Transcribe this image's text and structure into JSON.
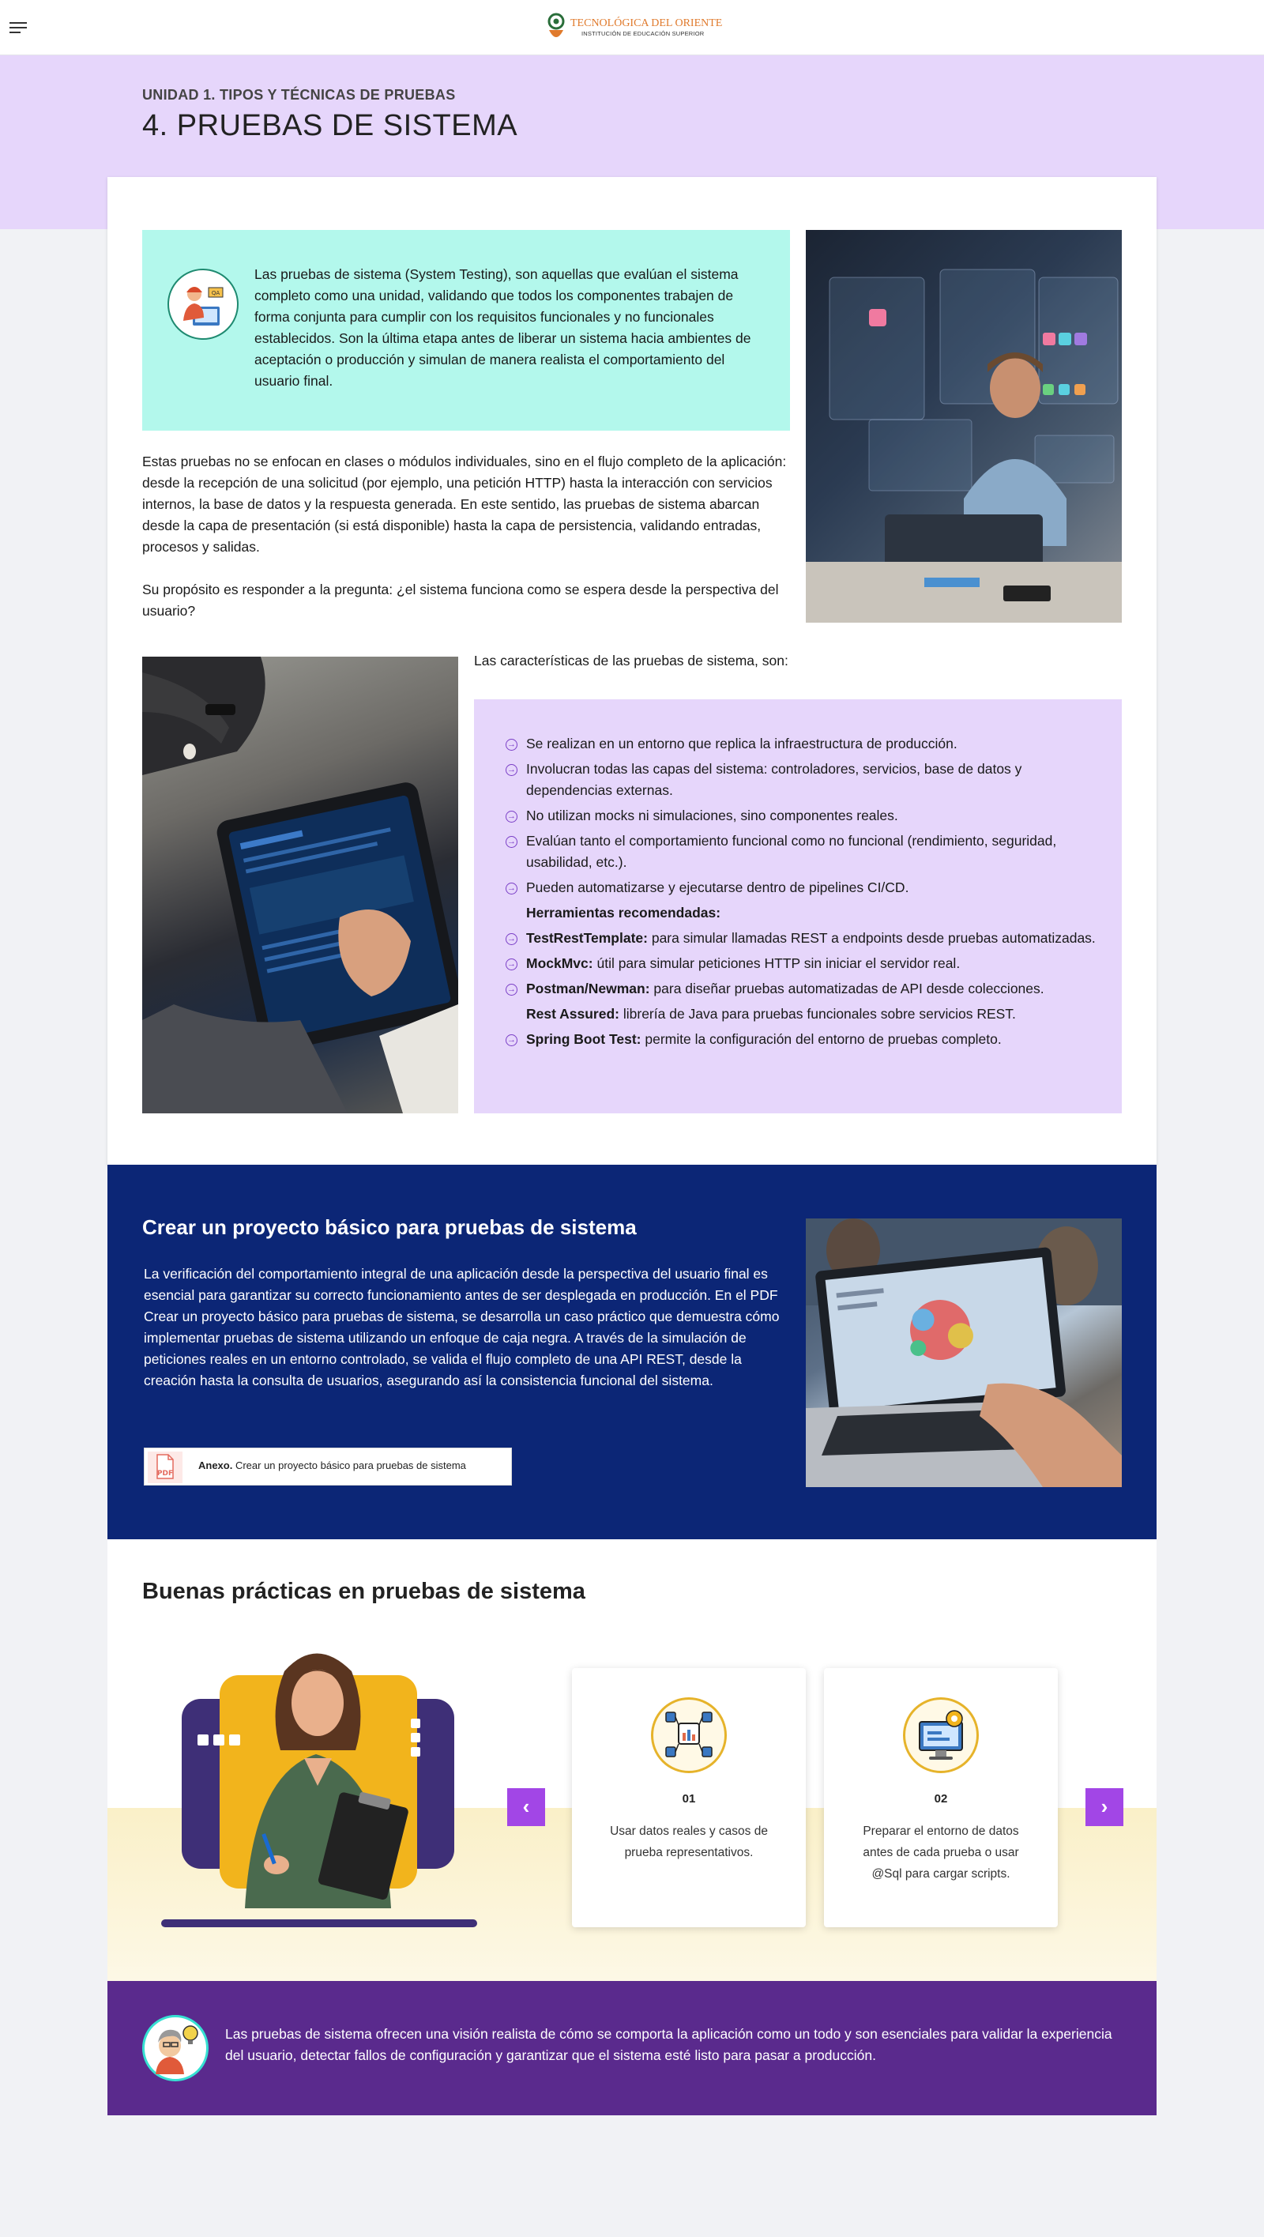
{
  "header": {
    "logo_title": "TECNOLÓGICA DEL ORIENTE",
    "logo_subtitle": "INSTITUCIÓN DE EDUCACIÓN SUPERIOR"
  },
  "hero": {
    "unit": "UNIDAD 1. TIPOS Y TÉCNICAS DE PRUEBAS",
    "title": "4.  PRUEBAS DE SISTEMA"
  },
  "intro": {
    "text": "Las pruebas de sistema (System Testing), son aquellas que evalúan el sistema completo como una unidad, validando que todos los componentes trabajen de forma conjunta para cumplir con los requisitos funcionales y no funcionales establecidos. Son la última etapa antes de liberar un sistema hacia ambientes de aceptación o producción y simulan de manera realista el comportamiento del usuario final."
  },
  "body": {
    "p1": "Estas pruebas no se enfocan en clases o módulos individuales, sino en el flujo completo de la aplicación: desde la recepción de una solicitud (por ejemplo, una petición HTTP) hasta la interacción con servicios internos, la base de datos y la respuesta generada. En este sentido, las pruebas de sistema abarcan desde la capa de presentación (si está disponible) hasta la capa de persistencia, validando entradas, procesos y salidas.",
    "p2": "Su propósito es responder a la pregunta: ¿el sistema funciona como se espera desde la perspectiva del usuario?"
  },
  "characteristics": {
    "title": "Las características de las pruebas de sistema, son:",
    "items": [
      {
        "bold": "",
        "text": "Se realizan en un entorno que replica la infraestructura de producción.",
        "arrow": true
      },
      {
        "bold": "",
        "text": "Involucran todas las capas del sistema: controladores, servicios, base de datos y dependencias externas.",
        "arrow": true
      },
      {
        "bold": "",
        "text": "No utilizan mocks ni simulaciones, sino componentes reales.",
        "arrow": true
      },
      {
        "bold": "",
        "text": "Evalúan tanto el comportamiento funcional como no funcional (rendimiento, seguridad, usabilidad, etc.).",
        "arrow": true
      },
      {
        "bold": "",
        "text": "Pueden automatizarse y ejecutarse dentro de pipelines CI/CD.",
        "arrow": true
      },
      {
        "bold": "Herramientas recomendadas:",
        "text": "",
        "arrow": false
      },
      {
        "bold": "TestRestTemplate:",
        "text": " para simular llamadas REST a endpoints desde pruebas automatizadas.",
        "arrow": true
      },
      {
        "bold": "MockMvc:",
        "text": " útil para simular peticiones HTTP sin iniciar el servidor real.",
        "arrow": true
      },
      {
        "bold": "Postman/Newman:",
        "text": " para diseñar pruebas automatizadas de API desde colecciones.",
        "arrow": true
      },
      {
        "bold": "Rest Assured:",
        "text": " librería de Java para pruebas funcionales sobre servicios REST.",
        "arrow": false
      },
      {
        "bold": "Spring Boot Test:",
        "text": " permite la configuración del entorno de pruebas completo.",
        "arrow": true
      }
    ]
  },
  "project": {
    "title": "Crear un proyecto básico para pruebas de sistema",
    "text": "La verificación del comportamiento integral de una aplicación desde la perspectiva del usuario final es esencial para garantizar su correcto funcionamiento antes de ser desplegada en producción. En el PDF Crear un proyecto básico para pruebas de sistema, se desarrolla un caso práctico que demuestra cómo implementar pruebas de sistema utilizando un enfoque de caja negra. A través de la simulación de peticiones reales en un entorno controlado, se valida el flujo completo de una API REST, desde la creación hasta la consulta de usuarios, asegurando así la consistencia funcional del sistema.",
    "attachment_bold": "Anexo.",
    "attachment_text": " Crear un proyecto básico para pruebas de sistema",
    "pdf_label": "PDF"
  },
  "practices": {
    "title": "Buenas prácticas en pruebas de sistema",
    "cards": [
      {
        "num": "01",
        "text": "Usar datos reales y casos de prueba representativos."
      },
      {
        "num": "02",
        "text": "Preparar el entorno de datos antes de cada prueba o usar @Sql para cargar scripts."
      }
    ],
    "prev": "‹",
    "next": "›"
  },
  "closing": {
    "text": "Las pruebas de sistema ofrecen una visión realista de cómo se comporta la aplicación como un todo y son esenciales para validar la experiencia del usuario, detectar fallos de configuración y garantizar que el sistema esté listo para pasar a producción."
  },
  "colors": {
    "hero_bg": "#e6d6fb",
    "intro_bg": "#b3f8ec",
    "navy": "#0c2676",
    "purple": "#5a2a8d",
    "accent": "#a246e6"
  }
}
